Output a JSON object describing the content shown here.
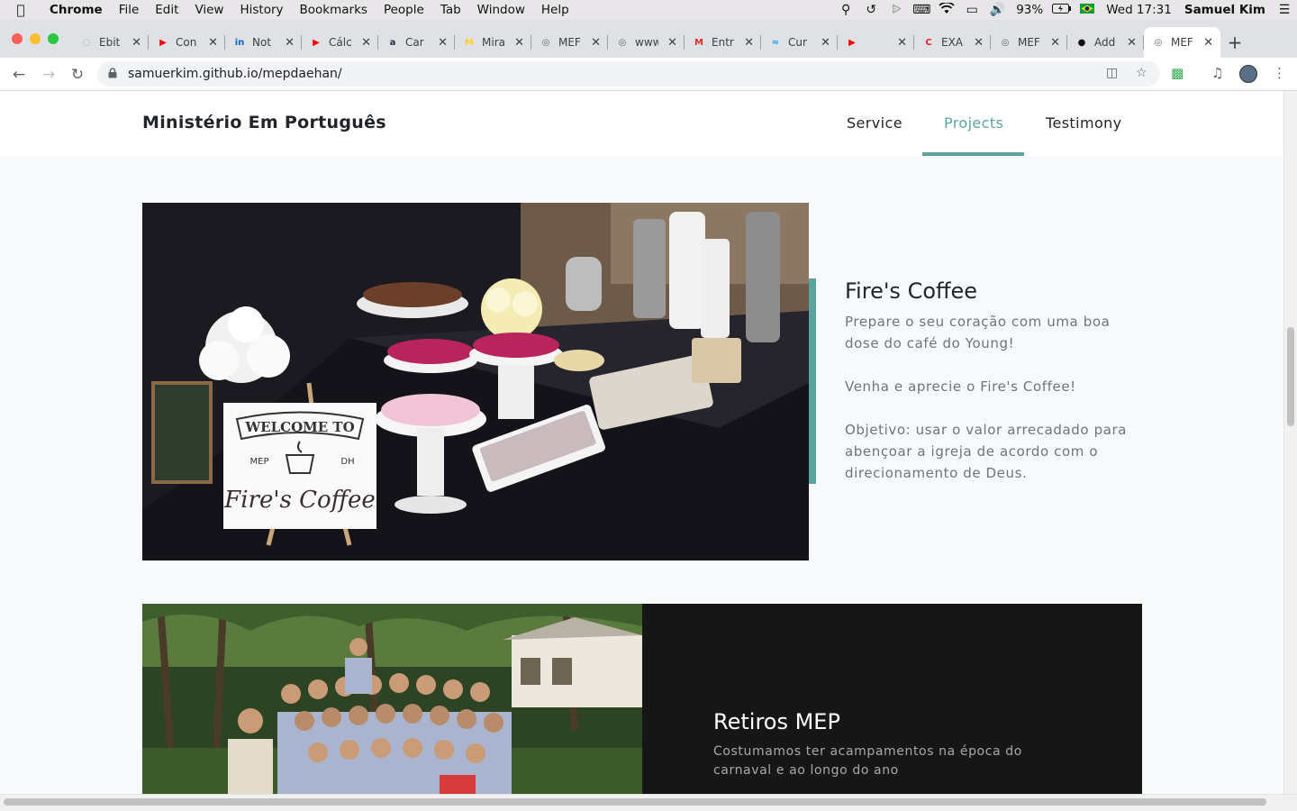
{
  "menubar": {
    "app": "Chrome",
    "items": [
      "File",
      "Edit",
      "View",
      "History",
      "Bookmarks",
      "People",
      "Tab",
      "Window",
      "Help"
    ],
    "battery": "93%",
    "clock": "Wed 17:31",
    "user": "Samuel Kim"
  },
  "tabs": [
    {
      "label": "Ebit",
      "favicon": "loading-icon",
      "color": "#9aa0a6"
    },
    {
      "label": "Con",
      "favicon": "youtube-icon",
      "color": "#ff0000"
    },
    {
      "label": "Not",
      "favicon": "linkedin-icon",
      "color": "#0a66c2"
    },
    {
      "label": "Cálc",
      "favicon": "youtube-icon",
      "color": "#ff0000"
    },
    {
      "label": "Car",
      "favicon": "amazon-icon",
      "color": "#232f3e"
    },
    {
      "label": "Mira",
      "favicon": "miro-icon",
      "color": "#ffd02f"
    },
    {
      "label": "MEF",
      "favicon": "globe-icon",
      "color": "#5f6368"
    },
    {
      "label": "www",
      "favicon": "globe-icon",
      "color": "#5f6368"
    },
    {
      "label": "Entr",
      "favicon": "gmail-icon",
      "color": "#d93025"
    },
    {
      "label": "Cur",
      "favicon": "bird-icon",
      "color": "#1da1f2"
    },
    {
      "label": "",
      "favicon": "youtube-icon",
      "color": "#ff0000"
    },
    {
      "label": "EXA",
      "favicon": "c-icon",
      "color": "#e8213b"
    },
    {
      "label": "MEF",
      "favicon": "globe-icon",
      "color": "#5f6368"
    },
    {
      "label": "Add",
      "favicon": "github-icon",
      "color": "#111111"
    },
    {
      "label": "MEF",
      "favicon": "globe-icon",
      "color": "#5f6368",
      "active": true
    }
  ],
  "address": {
    "url": "samuerkim.github.io/mepdaehan/"
  },
  "site": {
    "brand": "Ministério Em Português",
    "nav": [
      {
        "label": "Service"
      },
      {
        "label": "Projects",
        "active": true
      },
      {
        "label": "Testimony"
      }
    ],
    "accent_color": "#5ba39e"
  },
  "projects": [
    {
      "title": "Fire's Coffee",
      "paragraphs": [
        "Prepare o seu coração com uma boa dose do café do Young!",
        "Venha e aprecie o Fire's Coffee!",
        "Objetivo: usar o valor arrecadado para abençoar a igreja de acordo com o direcionamento de Deus."
      ],
      "sign": {
        "line1": "WELCOME TO",
        "left": "MEP",
        "right": "DH",
        "line2": "Fire's Coffee"
      }
    },
    {
      "title": "Retiros MEP",
      "description": "Costumamos ter acampamentos na época do carnaval e ao longo do ano"
    }
  ]
}
